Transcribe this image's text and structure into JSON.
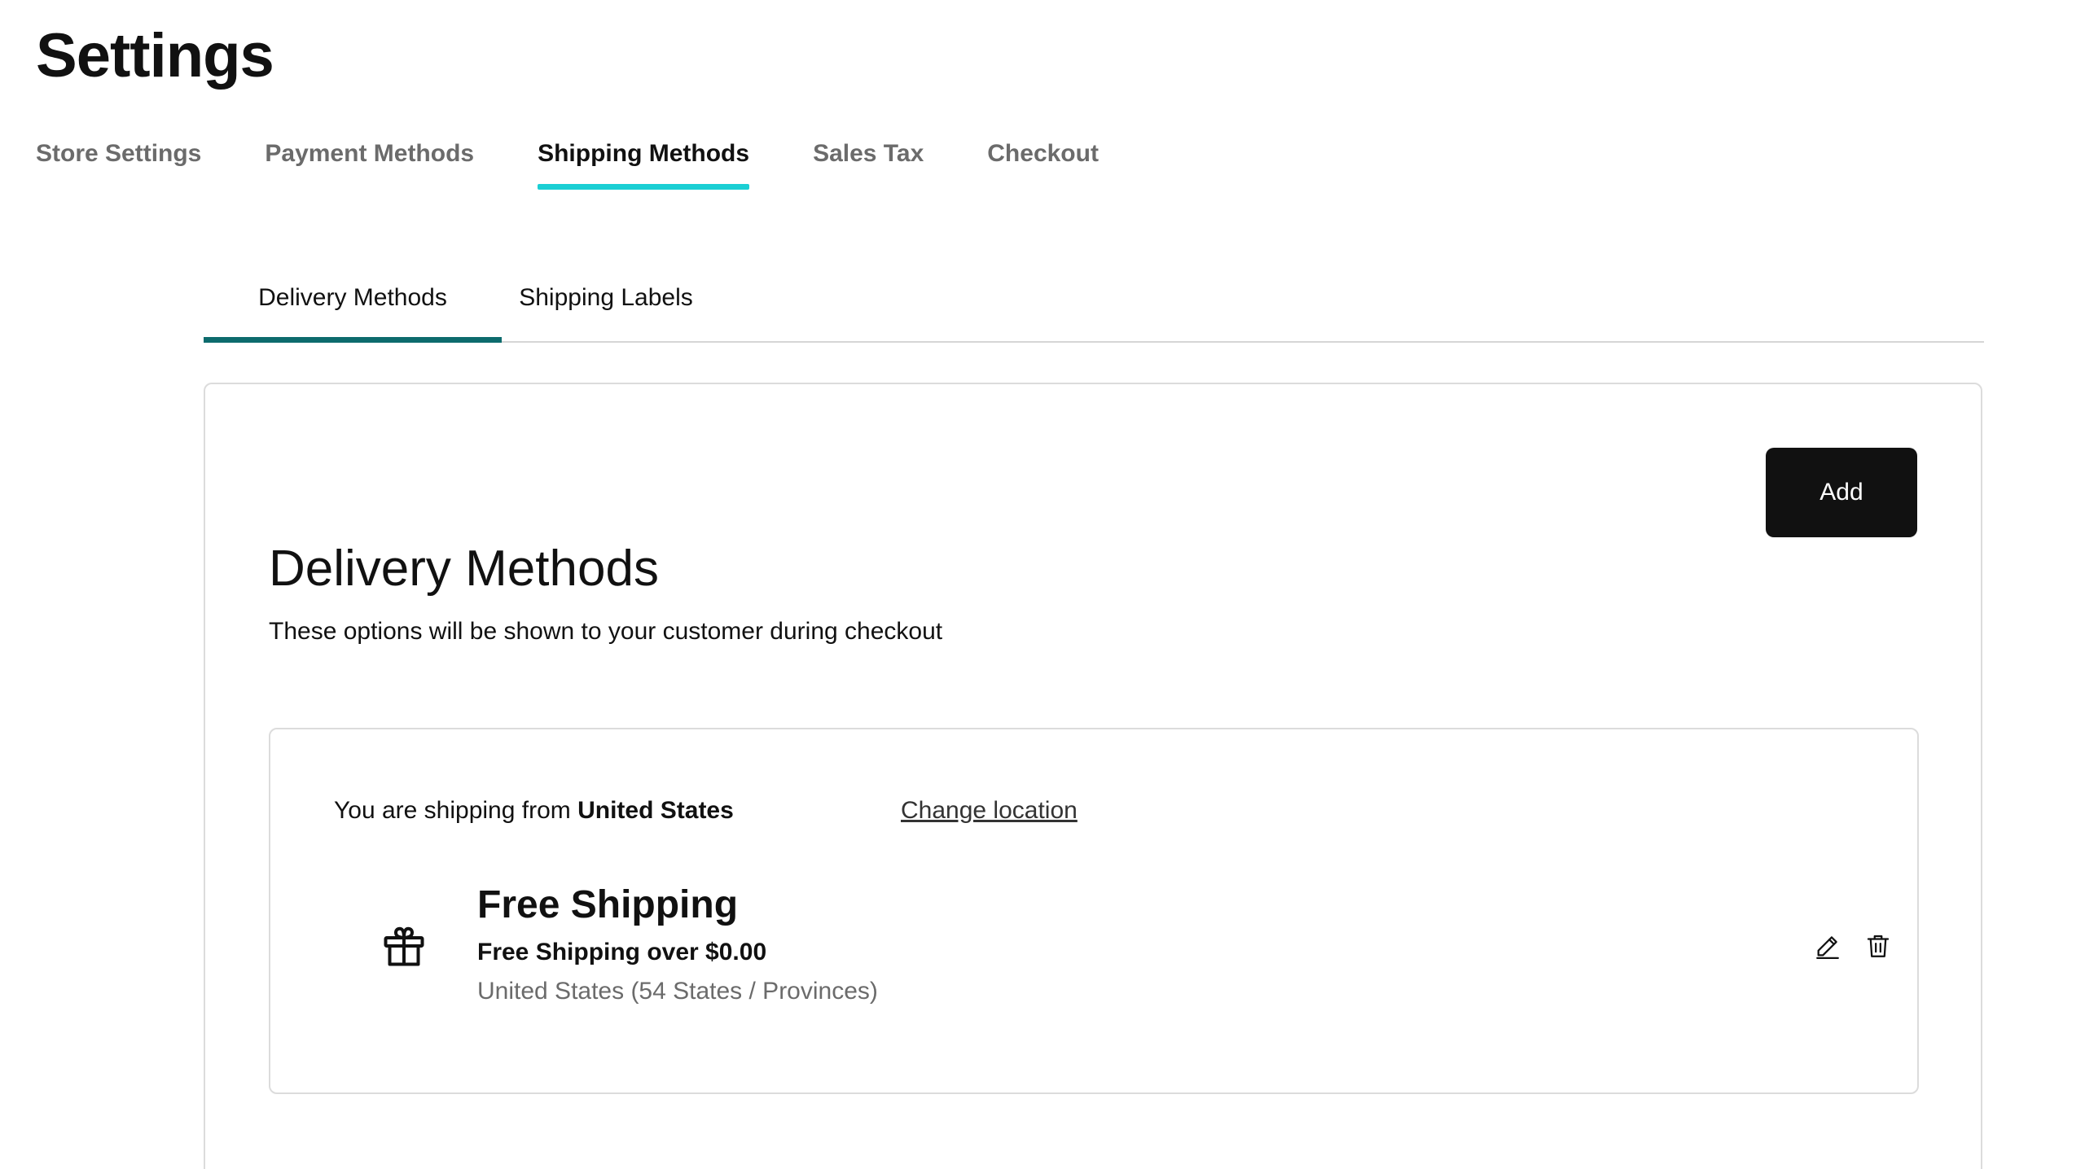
{
  "page": {
    "title": "Settings"
  },
  "top_tabs": [
    {
      "label": "Store Settings",
      "active": false
    },
    {
      "label": "Payment Methods",
      "active": false
    },
    {
      "label": "Shipping Methods",
      "active": true
    },
    {
      "label": "Sales Tax",
      "active": false
    },
    {
      "label": "Checkout",
      "active": false
    }
  ],
  "sub_tabs": [
    {
      "label": "Delivery Methods",
      "active": true
    },
    {
      "label": "Shipping Labels",
      "active": false
    }
  ],
  "delivery": {
    "add_label": "Add",
    "title": "Delivery Methods",
    "description": "These options will be shown to your customer during checkout",
    "ship_from_prefix": "You are shipping from",
    "ship_from_country": "United States",
    "change_location_label": "Change location",
    "methods": [
      {
        "icon": "gift-icon",
        "name": "Free Shipping",
        "subtitle": "Free Shipping over $0.00",
        "region": "United States (54 States / Provinces)"
      }
    ]
  },
  "colors": {
    "top_tab_indicator": "#1bcfd4",
    "sub_tab_indicator": "#0d6b6d",
    "primary_button": "#111111",
    "muted_text": "#6b6b6b"
  },
  "icons": {
    "edit": "pencil-icon",
    "delete": "trash-icon"
  }
}
